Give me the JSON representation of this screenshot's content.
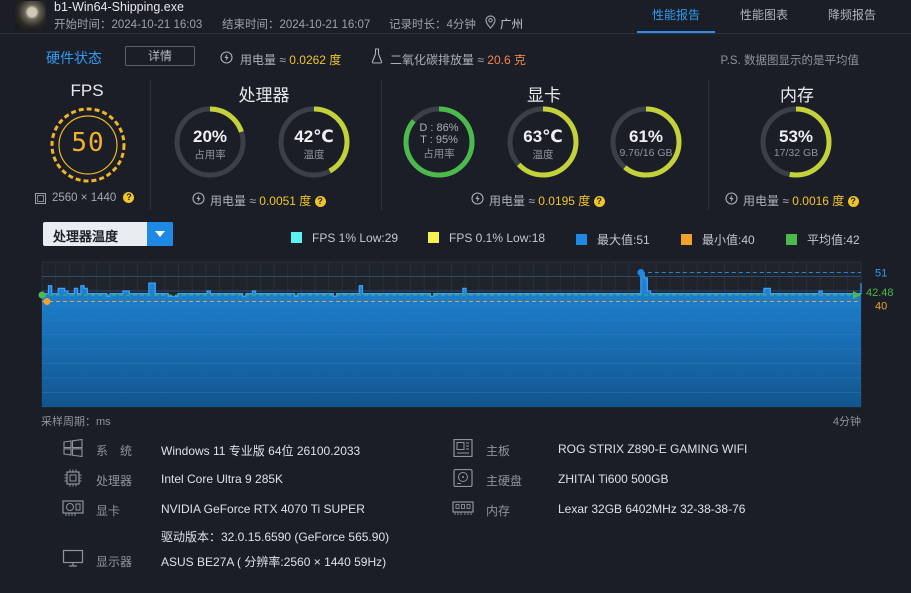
{
  "header": {
    "app_name": "b1-Win64-Shipping.exe",
    "start_time": "开始时间：2024-10-21 16:03",
    "end_time": "结束时间：2024-10-21 16:07",
    "duration": "记录时长：4分钟",
    "location": "广州",
    "tabs": [
      "性能报告",
      "性能图表",
      "降频报告"
    ],
    "active_tab": 0
  },
  "summary": {
    "hardware_status": "硬件状态",
    "detail_button": "详情",
    "power_label": "用电量 ≈",
    "power_value": "0.0262 度",
    "co2_label": "二氧化碳排放量 ≈",
    "co2_value": "20.6 克",
    "ps_note": "P.S. 数据图显示的是平均值"
  },
  "fps": {
    "title": "FPS",
    "value": "50",
    "resolution": "2560 × 1440"
  },
  "cpu": {
    "title": "处理器",
    "usage": {
      "value": "20%",
      "label": "占用率",
      "level": 0.2
    },
    "temp": {
      "value": "42℃",
      "label": "温度",
      "level": 0.42
    },
    "power_label": "用电量 ≈",
    "power_value": "0.0051 度"
  },
  "gpu": {
    "title": "显卡",
    "load": {
      "line1": "D : 86%",
      "line2": "T : 95%",
      "label": "占用率",
      "level": 0.86
    },
    "temp": {
      "value": "63℃",
      "label": "温度",
      "level": 0.63
    },
    "vram": {
      "value": "61%",
      "label": "9.76/16 GB",
      "level": 0.61
    },
    "power_label": "用电量 ≈",
    "power_value": "0.0195 度"
  },
  "memory": {
    "title": "内存",
    "usage": {
      "value": "53%",
      "label": "17/32 GB",
      "level": 0.53
    },
    "power_label": "用电量 ≈",
    "power_value": "0.0016 度"
  },
  "chart_controls": {
    "dropdown_value": "处理器温度",
    "legend": [
      {
        "label": "FPS 1% Low:29",
        "color": "#5df2f2"
      },
      {
        "label": "FPS 0.1% Low:18",
        "color": "#f5f24f"
      },
      {
        "label": "最大值:51",
        "color": "#1e88e5"
      },
      {
        "label": "最小值:40",
        "color": "#f0a22a"
      },
      {
        "label": "平均值:42",
        "color": "#4cb94c"
      }
    ]
  },
  "chart_data": {
    "type": "area",
    "series_label": "处理器温度",
    "max": 51,
    "min": 40,
    "avg": 42.48,
    "max_label": "51",
    "min_label": "40",
    "avg_label": "42.48",
    "ylim": [
      0,
      55
    ],
    "xlabel_left": "采样周期：ms",
    "xlabel_right": "4分钟",
    "values": [
      42,
      43,
      46,
      43,
      43,
      45,
      45,
      44,
      43,
      43,
      45,
      43,
      46,
      45,
      43,
      43,
      43,
      43,
      43,
      43,
      42,
      43,
      43,
      43,
      43,
      44,
      44,
      43,
      43,
      43,
      43,
      43,
      43,
      47,
      47,
      43,
      43,
      43,
      43,
      42,
      42,
      42,
      43,
      43,
      43,
      43,
      43,
      43,
      43,
      43,
      43,
      44,
      43,
      43,
      43,
      43,
      43,
      43,
      43,
      43,
      43,
      43,
      42,
      43,
      43,
      44,
      43,
      43,
      43,
      43,
      43,
      43,
      43,
      43,
      43,
      43,
      43,
      43,
      42,
      43,
      43,
      43,
      43,
      43,
      43,
      43,
      43,
      43,
      43,
      43,
      42,
      43,
      43,
      43,
      43,
      43,
      43,
      43,
      46,
      43,
      43,
      43,
      43,
      43,
      43,
      43,
      43,
      43,
      43,
      43,
      43,
      43,
      43,
      43,
      43,
      43,
      43,
      43,
      43,
      43,
      42,
      43,
      43,
      43,
      43,
      43,
      43,
      43,
      43,
      43,
      45,
      43,
      43,
      43,
      43,
      43,
      43,
      43,
      43,
      43,
      43,
      43,
      43,
      43,
      43,
      43,
      43,
      43,
      43,
      43,
      43,
      43,
      43,
      43,
      43,
      43,
      43,
      43,
      43,
      43,
      43,
      43,
      43,
      43,
      43,
      43,
      43,
      43,
      43,
      43,
      43,
      43,
      43,
      43,
      43,
      43,
      43,
      43,
      43,
      43,
      43,
      43,
      43,
      43,
      43,
      51,
      49,
      44,
      43,
      43,
      43,
      43,
      43,
      43,
      43,
      43,
      43,
      43,
      43,
      43,
      43,
      43,
      43,
      43,
      43,
      43,
      43,
      43,
      43,
      43,
      43,
      43,
      43,
      43,
      43,
      43,
      43,
      43,
      43,
      43,
      43,
      43,
      43,
      45,
      45,
      43,
      43,
      43,
      43,
      43,
      43,
      43,
      43,
      43,
      43,
      43,
      43,
      43,
      43,
      43,
      44,
      43,
      43,
      43,
      43,
      43,
      43,
      43,
      43,
      43,
      43,
      43,
      43,
      47
    ]
  },
  "specs": [
    {
      "icon": "windows-icon",
      "label": "系　统",
      "value": "Windows 11 专业版 64位 26100.2033"
    },
    {
      "icon": "cpu-icon",
      "label": "处理器",
      "value": "Intel Core Ultra 9 285K"
    },
    {
      "icon": "gpu-icon",
      "label": "显卡",
      "value": "NVIDIA GeForce RTX 4070 Ti SUPER",
      "extra": "驱动版本：32.0.15.6590 (GeForce 565.90)"
    },
    {
      "icon": "monitor-icon",
      "label": "显示器",
      "value": "ASUS BE27A ( 分辨率:2560 × 1440 59Hz)"
    },
    {
      "icon": "motherboard-icon",
      "label": "主板",
      "value": "ROG STRIX Z890-E GAMING WIFI"
    },
    {
      "icon": "disk-icon",
      "label": "主硬盘",
      "value": "ZHITAI Ti600 500GB"
    },
    {
      "icon": "memory-icon",
      "label": "内存",
      "value": "Lexar 32GB 6402MHz 32-38-38-76"
    }
  ]
}
